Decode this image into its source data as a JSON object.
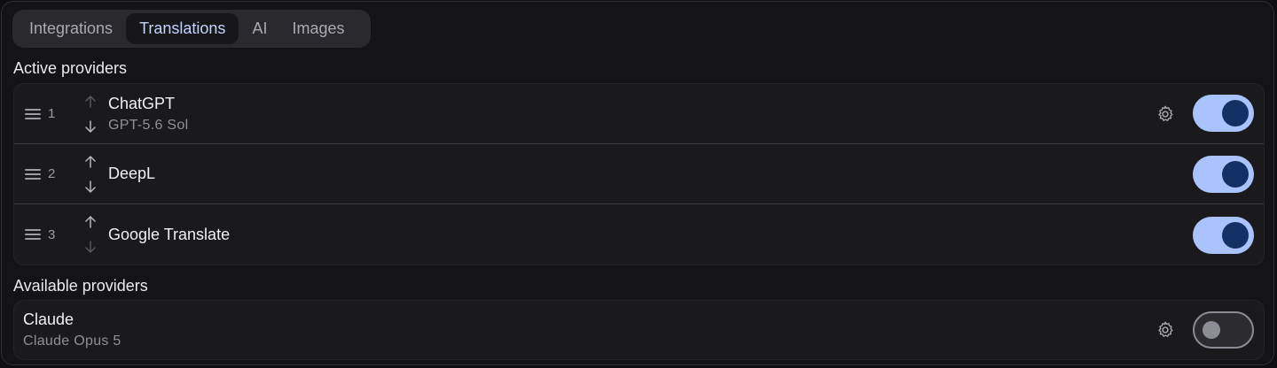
{
  "tabs": [
    {
      "label": "Integrations",
      "active": false
    },
    {
      "label": "Translations",
      "active": true
    },
    {
      "label": "AI",
      "active": false
    },
    {
      "label": "Images",
      "active": false
    }
  ],
  "active_section": {
    "title": "Active providers",
    "providers": [
      {
        "order": "1",
        "name": "ChatGPT",
        "model": "GPT-5.6 Sol",
        "enabled": true,
        "has_settings": true
      },
      {
        "order": "2",
        "name": "DeepL",
        "model": "",
        "enabled": true,
        "has_settings": false
      },
      {
        "order": "3",
        "name": "Google Translate",
        "model": "",
        "enabled": true,
        "has_settings": false
      }
    ]
  },
  "available_section": {
    "title": "Available providers",
    "providers": [
      {
        "name": "Claude",
        "model": "Claude Opus 5",
        "enabled": false,
        "has_settings": true
      }
    ]
  },
  "icons": {
    "drag": "drag-handle-icon",
    "up": "arrow-up-icon",
    "down": "arrow-down-icon",
    "settings": "gear-icon"
  },
  "colors": {
    "accent": "#aac3ff",
    "knob_on": "#143166",
    "active_tab_text": "#c3d2ff"
  }
}
